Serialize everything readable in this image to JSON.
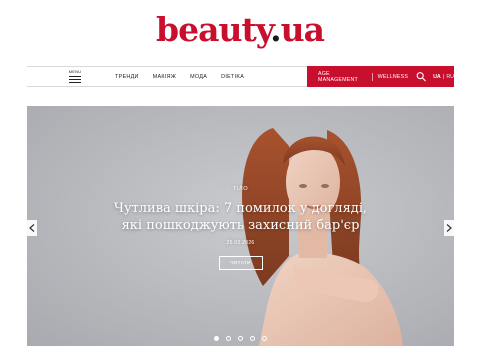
{
  "brand": {
    "name": "beauty",
    "dot": ".",
    "tld": "ua",
    "accent": "#c8102e"
  },
  "nav": {
    "menu_label": "MENU",
    "links": [
      "ТРЕНДИ",
      "МАКІЯЖ",
      "МОДА",
      "DIETIKA"
    ],
    "special_links": [
      "AGE MANAGEMENT",
      "WELLNESS"
    ],
    "search_icon": "search-icon",
    "languages": {
      "active": "UA",
      "separator": "|",
      "inactive": "RU"
    }
  },
  "hero": {
    "category": "ТІЛО",
    "title": "Чутлива шкіра: 7 помилок у догляді, які пошкоджують захисний бар'єр",
    "date": "25.03.2026",
    "button_label": "ЧИТАТИ",
    "slides_total": 5,
    "active_slide": 1,
    "prev_icon": "chevron-left-icon",
    "next_icon": "chevron-right-icon"
  }
}
